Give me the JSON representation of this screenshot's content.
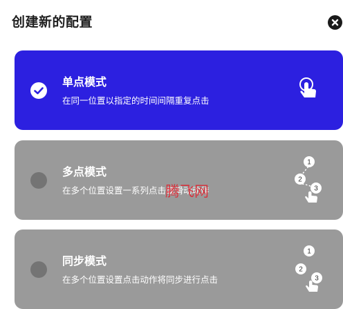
{
  "dialog": {
    "title": "创建新的配置",
    "close_icon": "close-icon"
  },
  "modes": [
    {
      "title": "单点模式",
      "description": "在同一位置以指定的时间间隔重复点击",
      "selected": true,
      "color": "#2c20e0",
      "icon": "tap-finger-icon"
    },
    {
      "title": "多点模式",
      "description": "在多个位置设置一系列点击或滑动动作",
      "selected": false,
      "color": "#9a9a9a",
      "icon": "multi-tap-icon",
      "steps": [
        "1",
        "2",
        "3"
      ]
    },
    {
      "title": "同步模式",
      "description": "在多个位置设置点击动作将同步进行点击",
      "selected": false,
      "color": "#9a9a9a",
      "icon": "sync-tap-icon",
      "steps": [
        "1",
        "2",
        "3"
      ]
    }
  ],
  "watermark": "腾飞网"
}
